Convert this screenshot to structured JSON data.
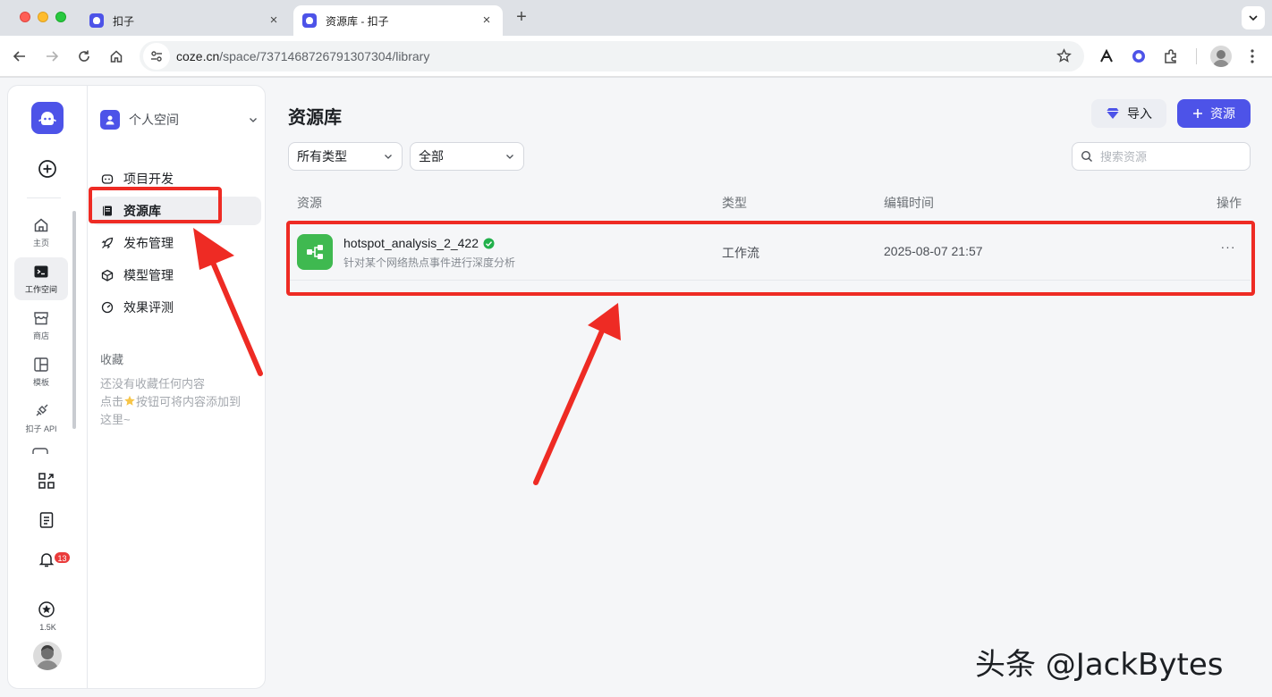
{
  "browser": {
    "tabs": [
      {
        "title": "扣子"
      },
      {
        "title": "资源库 - 扣子"
      }
    ],
    "url_host": "coze.cn",
    "url_path": "/space/7371468726791307304/library"
  },
  "rail": {
    "items": [
      {
        "label": "主页"
      },
      {
        "label": "工作空间"
      },
      {
        "label": "商店"
      },
      {
        "label": "模板"
      },
      {
        "label": "扣子 API"
      }
    ],
    "notification_count": "13",
    "star_count": "1.5K"
  },
  "sidenav": {
    "space_name": "个人空间",
    "items": [
      {
        "label": "项目开发"
      },
      {
        "label": "资源库"
      },
      {
        "label": "发布管理"
      },
      {
        "label": "模型管理"
      },
      {
        "label": "效果评测"
      }
    ],
    "favorites_title": "收藏",
    "favorites_empty_1": "还没有收藏任何内容",
    "favorites_empty_2a": "点击",
    "favorites_empty_2b": "按钮可将内容添加到",
    "favorites_empty_3": "这里~"
  },
  "main": {
    "title": "资源库",
    "import_label": "导入",
    "add_resource_label": "资源",
    "filter_type": "所有类型",
    "filter_scope": "全部",
    "search_placeholder": "搜索资源",
    "columns": {
      "resource": "资源",
      "type": "类型",
      "edit_time": "编辑时间",
      "actions": "操作"
    },
    "rows": [
      {
        "name": "hotspot_analysis_2_422",
        "description": "针对某个网络热点事件进行深度分析",
        "type": "工作流",
        "edit_time": "2025-08-07 21:57",
        "more": "···"
      }
    ]
  },
  "watermark": "头条 @JackBytes",
  "colors": {
    "brand": "#4d53e8",
    "workflow_icon": "#3fb950",
    "annotation": "#ee2b24",
    "verified": "#21b04b"
  }
}
